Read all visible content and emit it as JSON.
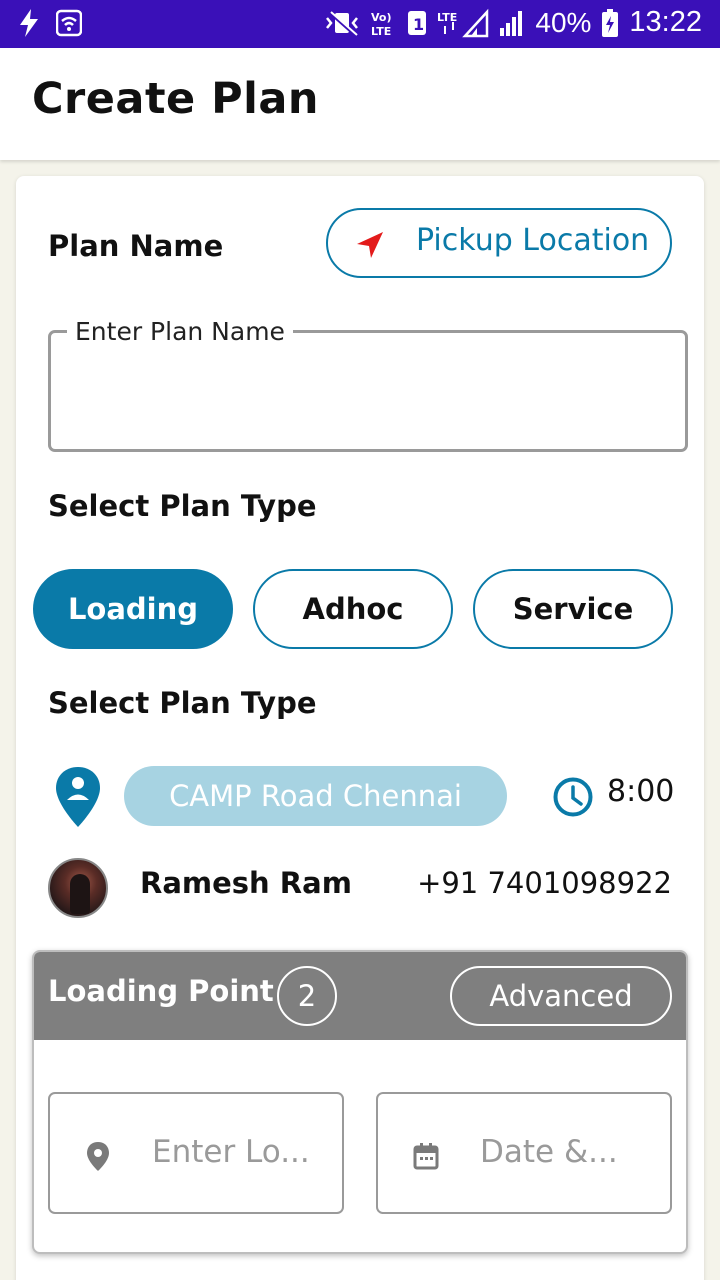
{
  "status_bar": {
    "battery": "40%",
    "time": "13:22",
    "icons": [
      "flash-icon",
      "wifi-icon",
      "vibrate-icon",
      "volte-icon",
      "sim-1-icon",
      "lte-signal-icon",
      "signal-icon",
      "battery-charging-icon"
    ]
  },
  "app_bar": {
    "title": "Create Plan"
  },
  "form": {
    "plan_name_label": "Plan Name",
    "pickup_button": "Pickup Location",
    "plan_name_input_label": "Enter Plan Name",
    "plan_name_value": "",
    "select_plan_type_label": "Select Plan Type",
    "plan_types": [
      {
        "label": "Loading",
        "selected": true
      },
      {
        "label": "Adhoc",
        "selected": false
      },
      {
        "label": "Service",
        "selected": false
      }
    ],
    "select_plan_type_label_2": "Select Plan Type"
  },
  "pickup": {
    "location": "CAMP Road Chennai",
    "time": "8:00"
  },
  "contact": {
    "name": "Ramesh Ram",
    "phone": "+91 7401098922"
  },
  "loading_point": {
    "title": "Loading Point",
    "count": "2",
    "advanced_button": "Advanced",
    "location_placeholder": "Enter Lo...",
    "date_placeholder": "Date &..."
  },
  "colors": {
    "status_bar": "#3a10b8",
    "accent": "#0a7aa8",
    "location_pill": "#a7d3e2",
    "panel_header": "#7f7f7f",
    "nav_arrow": "#e31b1b"
  }
}
